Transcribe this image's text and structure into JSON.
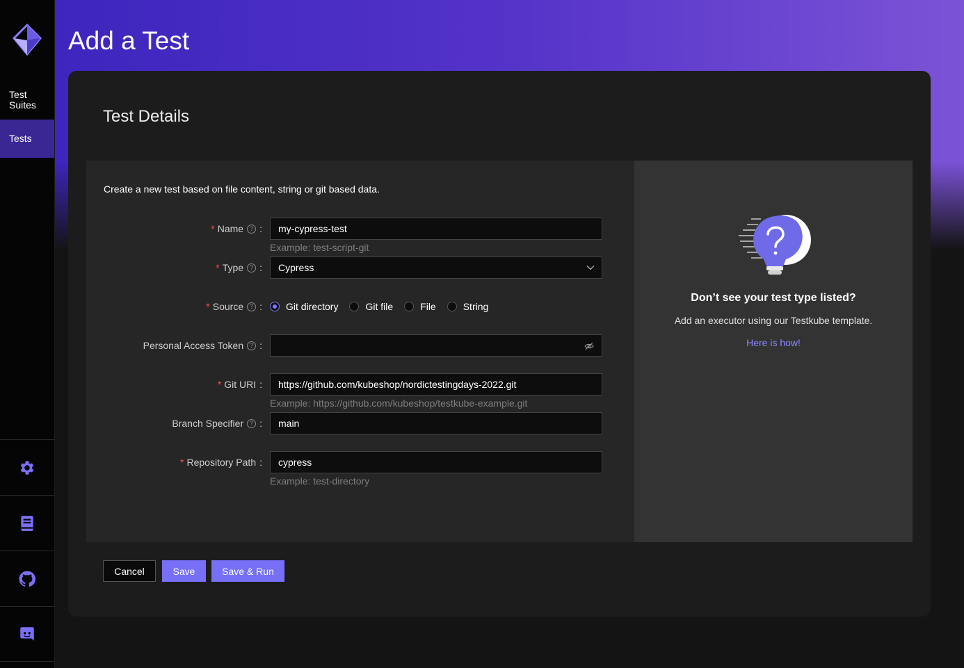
{
  "nav": {
    "suites_label": "Test\nSuites",
    "tests_label": "Tests",
    "bottom_icons": [
      "gear-icon",
      "book-icon",
      "github-icon",
      "discord-icon"
    ]
  },
  "page": {
    "title": "Add a Test"
  },
  "card": {
    "title": "Test Details"
  },
  "form": {
    "intro": "Create a new test based on file content, string or git based data.",
    "name": {
      "label": "Name",
      "value": "my-cypress-test",
      "hint": "Example: test-script-git"
    },
    "type": {
      "label": "Type",
      "value": "Cypress"
    },
    "source": {
      "label": "Source",
      "options": [
        "Git directory",
        "Git file",
        "File",
        "String"
      ],
      "selected": "Git directory"
    },
    "token": {
      "label": "Personal Access Token",
      "value": ""
    },
    "git_uri": {
      "label": "Git URI",
      "value": "https://github.com/kubeshop/nordictestingdays-2022.git",
      "hint": "Example: https://github.com/kubeshop/testkube-example.git"
    },
    "branch": {
      "label": "Branch Specifier",
      "value": "main"
    },
    "repo_path": {
      "label": "Repository Path",
      "value": "cypress",
      "hint": "Example: test-directory"
    }
  },
  "help": {
    "title": "Don’t see your test type listed?",
    "text": "Add an executor using our Testkube template.",
    "link": "Here is how!"
  },
  "actions": {
    "cancel": "Cancel",
    "save": "Save",
    "save_run": "Save & Run"
  },
  "colors": {
    "accent": "#7770f6",
    "required": "#ff4d4f",
    "link": "#8a86ff",
    "active_nav": "#3a2793"
  }
}
